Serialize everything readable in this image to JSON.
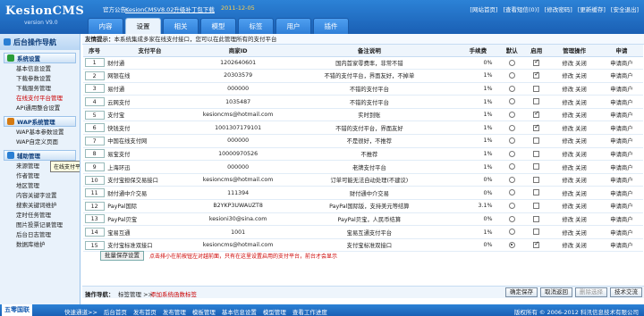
{
  "app": {
    "name": "KesionCMS",
    "version": "version V9.0"
  },
  "announce": {
    "label": "官方公告:",
    "link": "KesionCMSV8.02升级补丁包下载",
    "date": "2011-12-05"
  },
  "toplinks": [
    "[网站首页]",
    "[查看短信(0)]",
    "[修改密码]",
    "[更新缓存]",
    "[安全退出]"
  ],
  "tabs": [
    "内容",
    "设置",
    "相关",
    "模型",
    "标签",
    "用户",
    "插件"
  ],
  "sidebar": {
    "title": "后台操作导航",
    "groups": [
      {
        "title": "系统设置",
        "items": [
          "基本信息设置",
          "下载参数设置",
          "下载服务管理",
          "在线支付平台管理",
          "API通用整合设置"
        ]
      },
      {
        "title": "WAP系统管理",
        "items": [
          "WAP基本参数设置",
          "WAP自定义页面"
        ]
      },
      {
        "title": "辅助管理",
        "items": [
          "来源管理",
          "作者管理",
          "地区管理",
          "内容关键字设置",
          "搜索关键词维护",
          "定时任务管理",
          "图片投票记录管理",
          "后台日志管理",
          "数据库维护"
        ]
      }
    ],
    "tooltip": "在线支付平台管理"
  },
  "hint": {
    "label": "友情提示：",
    "text": "本系统集成多家在线支付接口，您可以在此管理所有的支付平台"
  },
  "table": {
    "headers": [
      "序号",
      "支付平台",
      "商家ID",
      "备注说明",
      "手续费",
      "默认",
      "启用",
      "管理操作",
      "申请"
    ],
    "rows": [
      {
        "no": "1",
        "name": "财付通",
        "id": "1202640601",
        "note": "国内首家零费率，非常不错",
        "fee": "0%",
        "def": false,
        "en": true
      },
      {
        "no": "2",
        "name": "网银在线",
        "id": "20303579",
        "note": "不错的支付平台，界面友好，不掉单",
        "fee": "1%",
        "def": false,
        "en": true
      },
      {
        "no": "3",
        "name": "易付通",
        "id": "000000",
        "note": "不错的支付平台",
        "fee": "1%",
        "def": false,
        "en": false
      },
      {
        "no": "4",
        "name": "云网支付",
        "id": "1035487",
        "note": "不错的支付平台",
        "fee": "1%",
        "def": false,
        "en": false
      },
      {
        "no": "5",
        "name": "支付宝",
        "id": "kesioncms@hotmail.com",
        "note": "实时到账",
        "fee": "1%",
        "def": false,
        "en": true
      },
      {
        "no": "6",
        "name": "快钱支付",
        "id": "1001307179101",
        "note": "不错的支付平台，界面友好",
        "fee": "1%",
        "def": false,
        "en": true
      },
      {
        "no": "7",
        "name": "中国在线支付网",
        "id": "000000",
        "note": "不是很好，不推荐",
        "fee": "1%",
        "def": false,
        "en": false
      },
      {
        "no": "8",
        "name": "易宝支付",
        "id": "10000970526",
        "note": "不推荐",
        "fee": "1%",
        "def": false,
        "en": false
      },
      {
        "no": "9",
        "name": "上海环迅",
        "id": "000000",
        "note": "老牌支付平台",
        "fee": "1%",
        "def": false,
        "en": false
      },
      {
        "no": "10",
        "name": "支付宝担保交易接口",
        "id": "kesioncms@hotmail.com",
        "note": "订单可能无法自动处理(不建议)",
        "fee": "0%",
        "def": false,
        "en": false
      },
      {
        "no": "11",
        "name": "财付通中介交易",
        "id": "111394",
        "note": "财付通中介交易",
        "fee": "0%",
        "def": false,
        "en": false
      },
      {
        "no": "12",
        "name": "PayPal国际",
        "id": "B2YKP3UWAUZT8",
        "note": "PayPal国际版，支持美元等结算",
        "fee": "3.1%",
        "def": false,
        "en": false
      },
      {
        "no": "13",
        "name": "PayPal贝宝",
        "id": "kesioni30@sina.com",
        "note": "PayPal贝宝，人民币结算",
        "fee": "0%",
        "def": false,
        "en": false
      },
      {
        "no": "14",
        "name": "宝易互通",
        "id": "1001",
        "note": "宝易互通支付平台",
        "fee": "1%",
        "def": false,
        "en": false
      },
      {
        "no": "15",
        "name": "支付宝标准双接口",
        "id": "kesioncms@hotmail.com",
        "note": "支付宝标准双接口",
        "fee": "0%",
        "def": true,
        "en": true
      }
    ],
    "ops": [
      "修改",
      "关闭"
    ],
    "apply": "申请商户"
  },
  "batch": {
    "button": "批量保存设置",
    "note": "点击排小在前按钮左对越前面，只有在这里设置启用的支付平台，前台才会显示"
  },
  "opbar": {
    "label": "操作导航：",
    "value": "标签管理 >>",
    "add": "添加系统函数标签",
    "buttons": [
      "确定保存",
      "取消返回",
      "删除选择",
      "技术交流"
    ]
  },
  "footer": {
    "brand": "五零国联",
    "links": [
      "快速通道>>",
      "后台首页",
      "发布首页",
      "发布管理",
      "模板管理",
      "基本信息设置",
      "模型管理",
      "查看工作进度"
    ],
    "copy": "版权所有 © 2006-2012 科汛信息技术有限公司"
  }
}
